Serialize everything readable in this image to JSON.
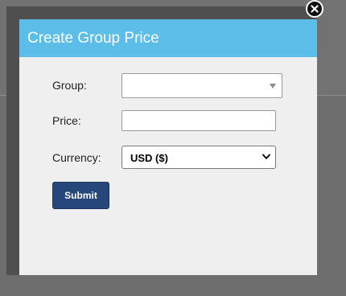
{
  "modal": {
    "title": "Create Group Price",
    "close_icon": "close-icon"
  },
  "form": {
    "group_label": "Group:",
    "group_value": "",
    "price_label": "Price:",
    "price_value": "",
    "currency_label": "Currency:",
    "currency_value": "USD ($)",
    "submit_label": "Submit"
  },
  "colors": {
    "header": "#5bbde8",
    "submit": "#25477a",
    "overlay": "#6e6e6e"
  }
}
